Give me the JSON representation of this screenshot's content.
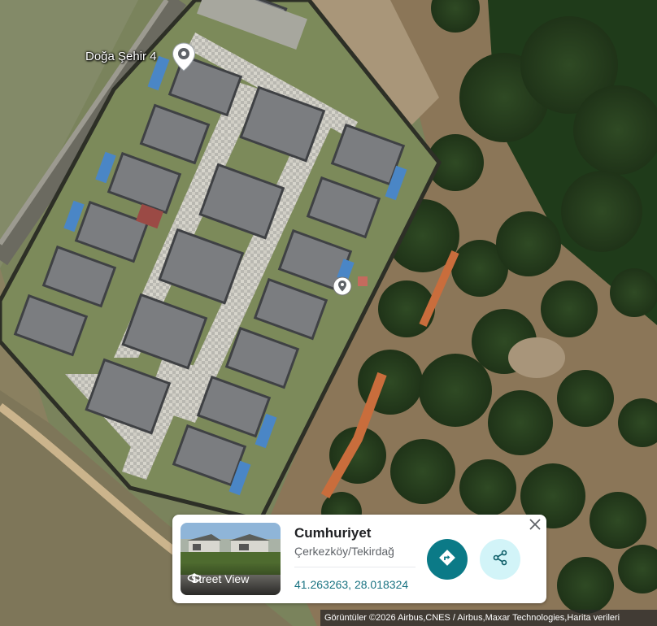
{
  "map": {
    "place_label": "Doğa Şehir 4",
    "imagery": "satellite"
  },
  "info_card": {
    "street_view_label": "Street View",
    "title": "Cumhuriyet",
    "subtitle": "Çerkezköy/Tekirdağ",
    "coordinates": "41.263263, 28.018324"
  },
  "attribution": "Görüntüler ©2026 Airbus,CNES / Airbus,Maxar Technologies,Harita verileri",
  "colors": {
    "accent": "#0b7a87",
    "share_bg": "#d2f4f8",
    "coords_link": "#1a7382"
  },
  "icons": {
    "place_pin": "map-pin-icon",
    "dropped_pin": "map-pin-icon",
    "street_view": "street-view-icon",
    "directions": "directions-icon",
    "share": "share-icon",
    "close": "close-icon"
  }
}
